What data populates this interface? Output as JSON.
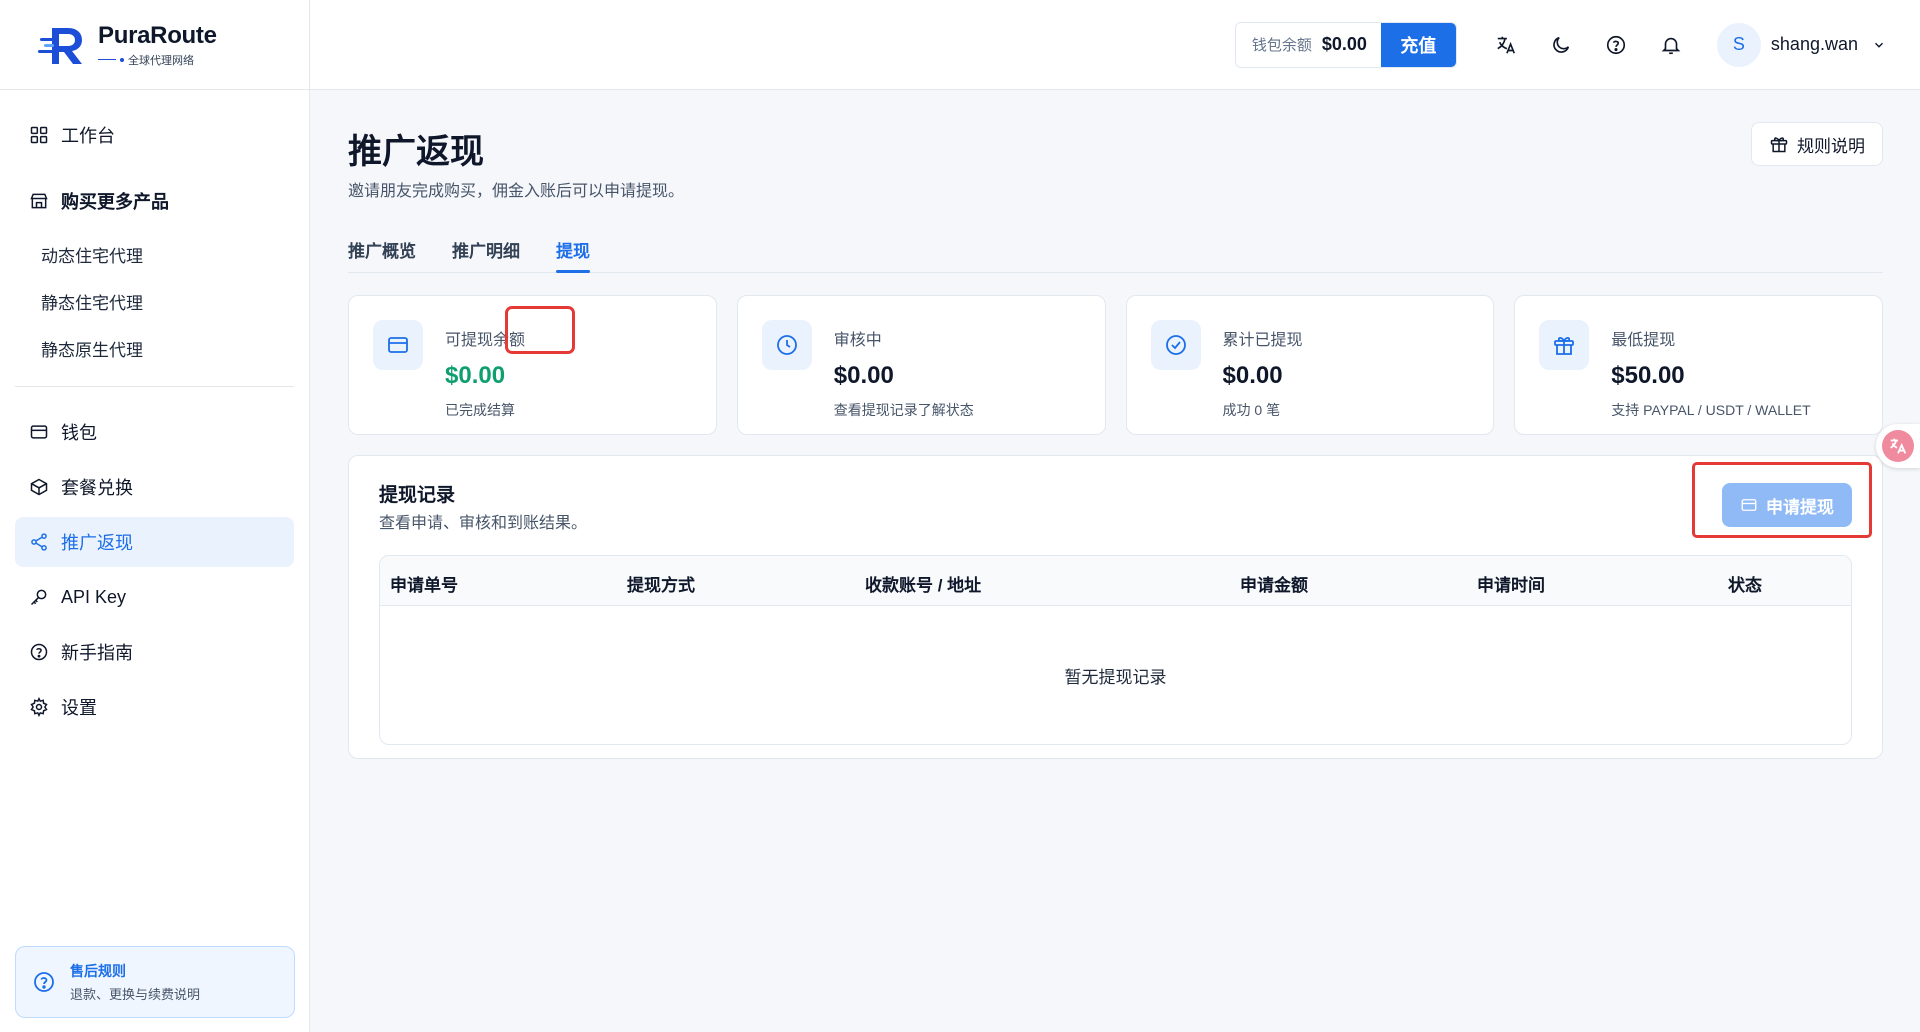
{
  "brand": {
    "name": "PuraRoute",
    "tagline": "全球代理网络"
  },
  "sidebar": {
    "workbench": "工作台",
    "buy_group": "购买更多产品",
    "products": [
      "动态住宅代理",
      "静态住宅代理",
      "静态原生代理"
    ],
    "items": [
      {
        "label": "钱包",
        "icon": "wallet-icon"
      },
      {
        "label": "套餐兑换",
        "icon": "package-icon"
      },
      {
        "label": "推广返现",
        "icon": "share-icon",
        "active": true
      },
      {
        "label": "API Key",
        "icon": "key-icon"
      },
      {
        "label": "新手指南",
        "icon": "help-circle-icon"
      },
      {
        "label": "设置",
        "icon": "gear-icon"
      }
    ],
    "help_card": {
      "title": "售后规则",
      "subtitle": "退款、更换与续费说明"
    }
  },
  "topbar": {
    "wallet_label": "钱包余额",
    "wallet_amount": "$0.00",
    "recharge_label": "充值",
    "avatar_initial": "S",
    "username": "shang.wan"
  },
  "page": {
    "title": "推广返现",
    "subtitle": "邀请朋友完成购买，佣金入账后可以申请提现。",
    "rules_button": "规则说明",
    "tabs": [
      "推广概览",
      "推广明细",
      "提现"
    ],
    "active_tab": 2
  },
  "stats": [
    {
      "label": "可提现余额",
      "value": "$0.00",
      "note": "已完成结算",
      "icon": "wallet-icon",
      "green": true
    },
    {
      "label": "审核中",
      "value": "$0.00",
      "note": "查看提现记录了解状态",
      "icon": "clock-icon"
    },
    {
      "label": "累计已提现",
      "value": "$0.00",
      "note": "成功 0 笔",
      "icon": "check-circle-icon"
    },
    {
      "label": "最低提现",
      "value": "$50.00",
      "note": "支持 PAYPAL / USDT / WALLET",
      "icon": "gift-icon"
    }
  ],
  "records": {
    "title": "提现记录",
    "subtitle": "查看申请、审核和到账结果。",
    "apply_button": "申请提现",
    "columns": [
      "申请单号",
      "提现方式",
      "收款账号 / 地址",
      "申请金额",
      "申请时间",
      "状态"
    ],
    "empty_text": "暂无提现记录"
  },
  "colors": {
    "accent": "#1d6fe8",
    "green": "#0e9f6e",
    "highlight": "#e53935"
  }
}
